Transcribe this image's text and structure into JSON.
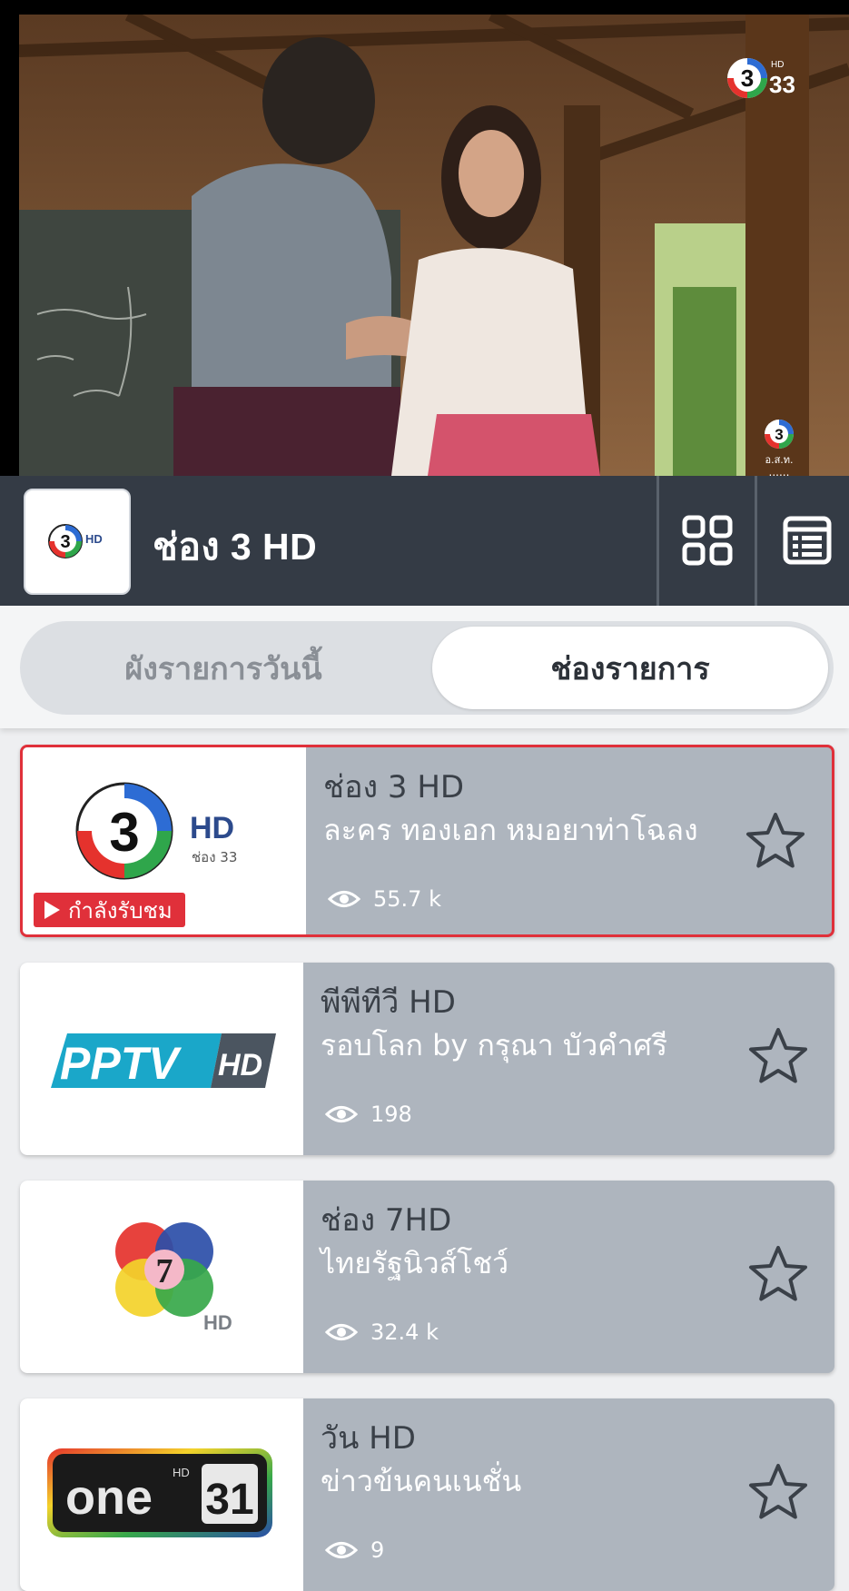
{
  "player": {
    "osd_channel": "3",
    "osd_hd": "HD",
    "osd_number": "33",
    "rating_mark": "อ.ส.ท."
  },
  "header": {
    "channel_name": "ช่อง 3 HD",
    "logo_hd": "HD",
    "grid_icon": "grid-icon",
    "list_icon": "list-icon"
  },
  "tabs": [
    {
      "label": "ผังรายการวันนี้",
      "active": false
    },
    {
      "label": "ช่องรายการ",
      "active": true
    }
  ],
  "channels": [
    {
      "name": "ช่อง 3 HD",
      "program": "ละคร ทองเอก หมอยาท่าโฉลง",
      "views": "55.7 k",
      "logo_text": "3",
      "logo_hd": "HD",
      "logo_sub": "ช่อง 33",
      "now_watching": "กำลังรับชม",
      "favorite": false
    },
    {
      "name": "พีพีทีวี HD",
      "program": "รอบโลก by กรุณา บัวคำศรี",
      "views": "198",
      "logo_text": "PPTV",
      "logo_hd": "HD",
      "favorite": false
    },
    {
      "name": "ช่อง 7HD",
      "program": "ไทยรัฐนิวส์โชว์",
      "views": "32.4 k",
      "logo_text": "7",
      "logo_hd": "HD",
      "favorite": false
    },
    {
      "name": "วัน HD",
      "program": "ข่าวข้นคนเนชั่น",
      "views": "9",
      "logo_text": "one",
      "logo_hd": "HD",
      "logo_num": "31",
      "favorite": false
    }
  ],
  "colors": {
    "header_bg": "#343b45",
    "card_bg": "#aeb5be",
    "accent_red": "#e0303a"
  }
}
